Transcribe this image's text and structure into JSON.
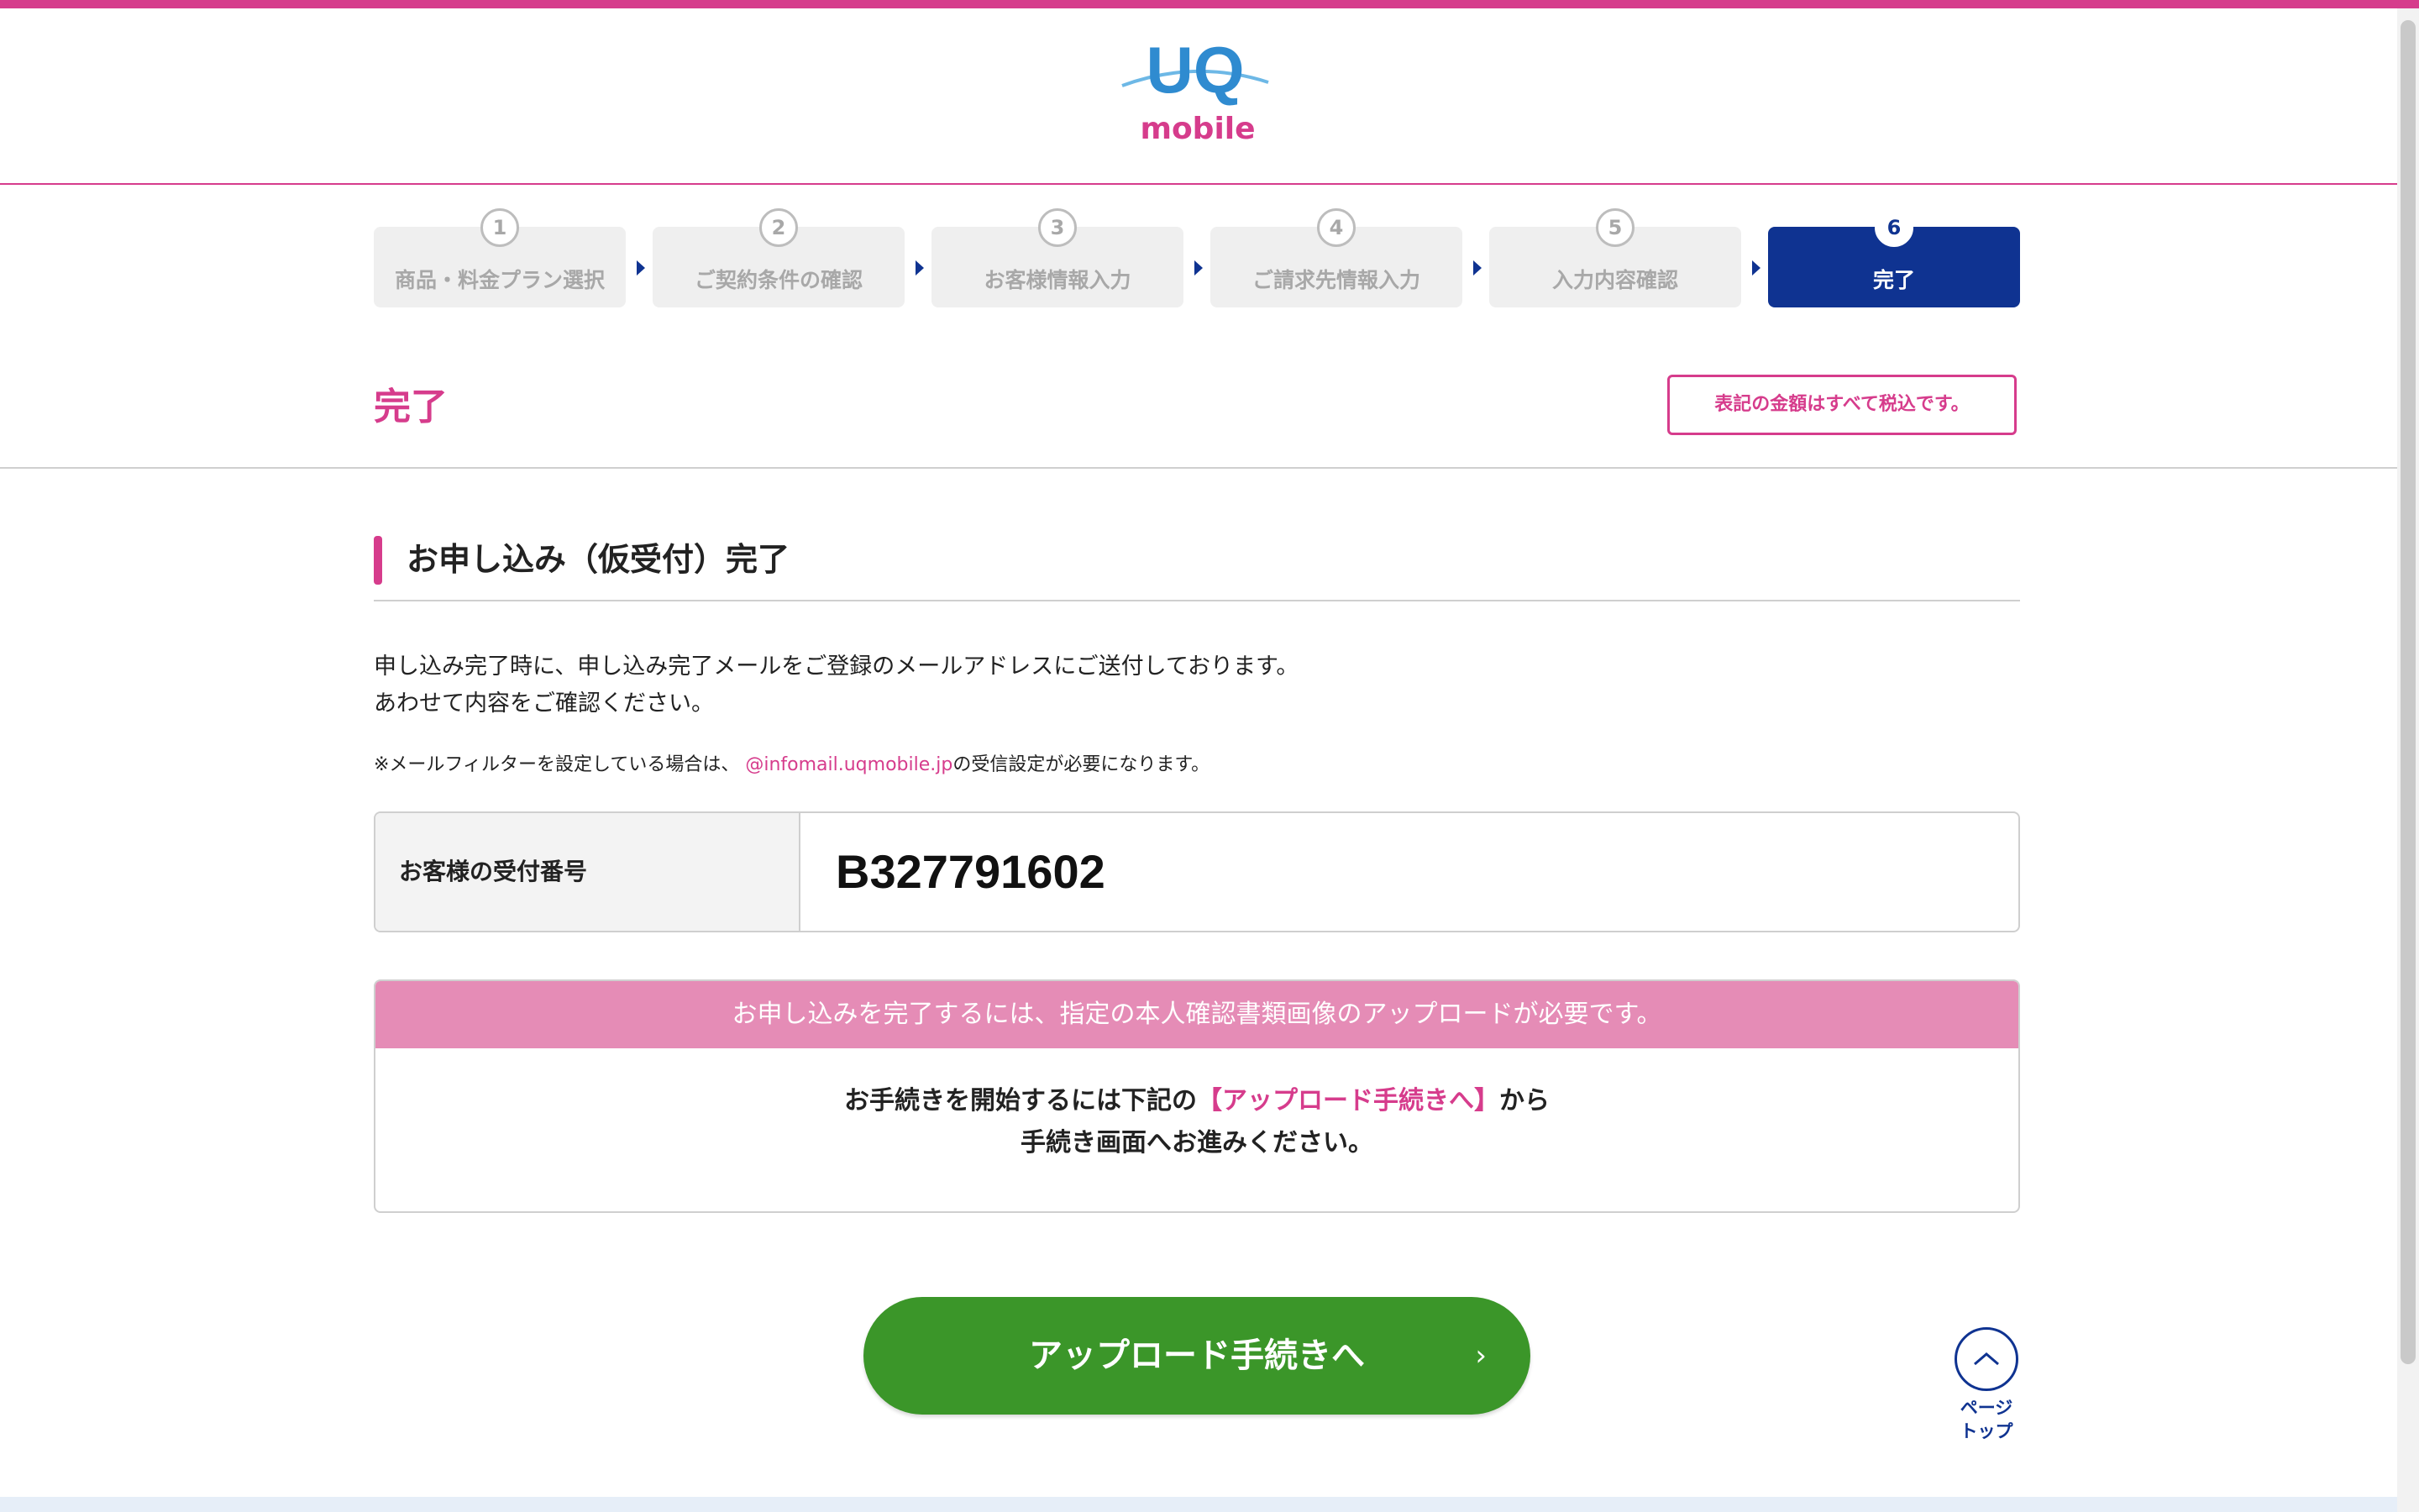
{
  "brand": {
    "logo_top": "UQ",
    "logo_bottom": "mobile",
    "accent": "#d63c8c",
    "navy": "#0f3391",
    "green": "#3b9629"
  },
  "steps": [
    {
      "num": "1",
      "label": "商品・料金プラン選択",
      "active": false
    },
    {
      "num": "2",
      "label": "ご契約条件の確認",
      "active": false
    },
    {
      "num": "3",
      "label": "お客様情報入力",
      "active": false
    },
    {
      "num": "4",
      "label": "ご請求先情報入力",
      "active": false
    },
    {
      "num": "5",
      "label": "入力内容確認",
      "active": false
    },
    {
      "num": "6",
      "label": "完了",
      "active": true
    }
  ],
  "page": {
    "title": "完了",
    "tax_note": "表記の金額はすべて税込です。"
  },
  "section": {
    "title": "お申し込み（仮受付）完了",
    "desc_line1": "申し込み完了時に、申し込み完了メールをご登録のメールアドレスにご送付しております。",
    "desc_line2": "あわせて内容をご確認ください。",
    "note_prefix": "※メールフィルターを設定している場合は、",
    "note_mail": "@infomail.uqmobile.jp",
    "note_suffix": "の受信設定が必要になります。"
  },
  "receipt": {
    "label": "お客様の受付番号",
    "number": "B327791602"
  },
  "notice": {
    "header": "お申し込みを完了するには、指定の本人確認書類画像のアップロードが必要です。",
    "body_pre": "お手続きを開始するには下記の",
    "body_link": "【アップロード手続きへ】",
    "body_post": "から",
    "body_line2": "手続き画面へお進みください。"
  },
  "upload_button": {
    "label": "アップロード手続きへ",
    "chevron": "›"
  },
  "page_top": {
    "line1": "ページ",
    "line2": "トップ",
    "icon": "chevron-up-icon"
  }
}
